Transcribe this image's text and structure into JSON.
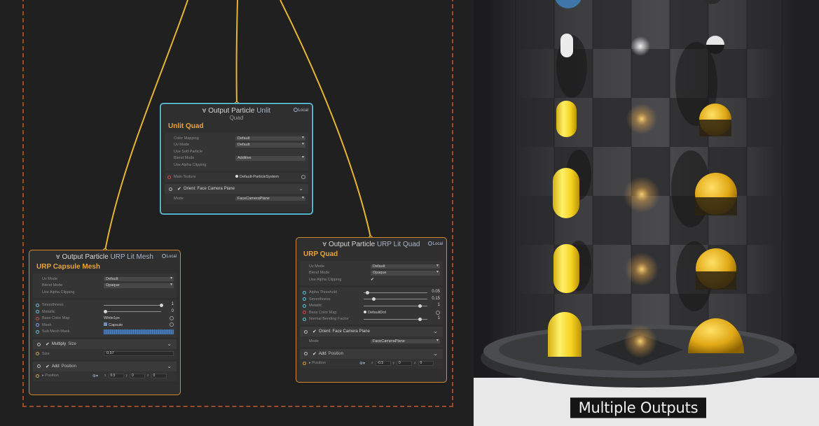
{
  "unlit_node": {
    "header_name": "Output Particle",
    "header_kind": "Unlit",
    "header_shape": "Quad",
    "space": "Local",
    "title": "Unlit Quad",
    "settings": [
      {
        "label": "Color Mapping",
        "value": "Default"
      },
      {
        "label": "Uv Mode",
        "value": "Default"
      },
      {
        "label": "Use Soft Particle",
        "value": ""
      },
      {
        "label": "Blend Mode",
        "value": "Additive"
      },
      {
        "label": "Use Alpha Clipping",
        "value": ""
      }
    ],
    "main_texture_label": "Main Texture",
    "main_texture_value": "Default-ParticleSystem",
    "orient_label": "Orient: Face Camera Plane",
    "mode_label": "Mode",
    "mode_value": "FaceCameraPlane"
  },
  "capsule_node": {
    "header_name": "Output Particle",
    "header_kind": "URP Lit",
    "header_shape": "Mesh",
    "space": "Local",
    "title": "URP Capsule Mesh",
    "settings": [
      {
        "label": "Uv Mode",
        "value": "Default"
      },
      {
        "label": "Blend Mode",
        "value": "Opaque"
      },
      {
        "label": "Use Alpha Clipping",
        "value": ""
      }
    ],
    "smoothness_label": "Smoothness",
    "smoothness_value": "1",
    "metallic_label": "Metallic",
    "metallic_value": "0",
    "base_color_map_label": "Base Color Map",
    "base_color_map_value": "White1px",
    "mesh_label": "Mesh",
    "mesh_value": "Capsule",
    "sub_mesh_label": "Sub Mesh Mask",
    "multiply_label": "Multiply",
    "size_label": "Size",
    "size_value": "0.57",
    "add_label": "Add",
    "position_label": "Position",
    "position_block_label": "Position",
    "pos_x": "0.5",
    "pos_y": "0",
    "pos_z": "0",
    "axis_x": "x",
    "axis_y": "y",
    "axis_z": "z"
  },
  "quad_node": {
    "header_name": "Output Particle",
    "header_kind": "URP Lit",
    "header_shape": "Quad",
    "space": "Local",
    "title": "URP Quad",
    "settings": [
      {
        "label": "Uv Mode",
        "value": "Default"
      },
      {
        "label": "Blend Mode",
        "value": "Opaque"
      }
    ],
    "alpha_clip_label": "Use Alpha Clipping",
    "alpha_clip_check": "✔",
    "alpha_threshold_label": "Alpha Threshold",
    "alpha_threshold_value": "0.05",
    "smoothness_label": "Smoothness",
    "smoothness_value": "0.15",
    "metallic_label": "Metallic",
    "metallic_value": "1",
    "base_color_map_label": "Base Color Map",
    "base_color_map_value": "DefaultDot",
    "normal_bending_label": "Normal Bending Factor",
    "normal_bending_value": "1",
    "orient_label": "Orient: Face Camera Plane",
    "mode_label": "Mode",
    "mode_value": "FaceCameraPlane",
    "add_label": "Add",
    "position_label": "Position",
    "position_block_label": "Position",
    "pos_x": "-0.5",
    "pos_y": "0",
    "pos_z": "0",
    "axis_x": "x",
    "axis_y": "y",
    "axis_z": "z"
  },
  "viewport": {
    "caption": "Multiple Outputs"
  },
  "colors": {
    "wire": "#e6b332",
    "unlit_border": "#56b4c8",
    "urp_border": "#d0892d",
    "title_orange": "#e9a33c",
    "group_dash": "#9c4b2a",
    "capsule_yellow": "#f5d21f"
  },
  "icons": {
    "collapse": "chevron-down-icon",
    "space": "local-space-icon",
    "check": "checkmark-icon",
    "target": "object-picker-icon"
  }
}
